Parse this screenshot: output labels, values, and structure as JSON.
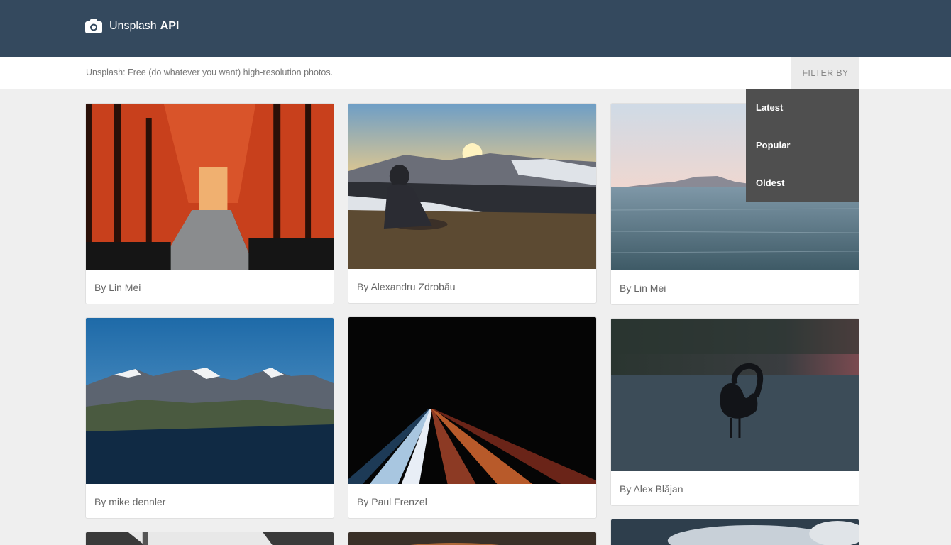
{
  "header": {
    "brand_name": "Unsplash",
    "brand_bold": "API",
    "logo_icon": "camera-icon",
    "background_color": "#34495e"
  },
  "subbar": {
    "tagline": "Unsplash: Free (do whatever you want) high-resolution photos.",
    "filter_label": "FILTER BY"
  },
  "filter_menu": {
    "open": true,
    "options": [
      "Latest",
      "Popular",
      "Oldest"
    ]
  },
  "photos": [
    {
      "caption": "By Lin Mei",
      "subject": "red torii gates path"
    },
    {
      "caption": "By Alexandru Zdrobău",
      "subject": "person sitting watching mountain sunset"
    },
    {
      "caption": "By Lin Mei",
      "subject": "sea with distant island"
    },
    {
      "caption": "By mike dennler",
      "subject": "snowy mountain range under blue sky"
    },
    {
      "caption": "By Paul Frenzel",
      "subject": "light trails on dark road"
    },
    {
      "caption": "By Alex Blăjan",
      "subject": "black swan on dusky lake"
    },
    {
      "caption": "",
      "subject": "architecture (partially visible)"
    },
    {
      "caption": "",
      "subject": "cloudy sky (partially visible)"
    },
    {
      "caption": "",
      "subject": "dramatic clouds (partially visible)"
    }
  ]
}
